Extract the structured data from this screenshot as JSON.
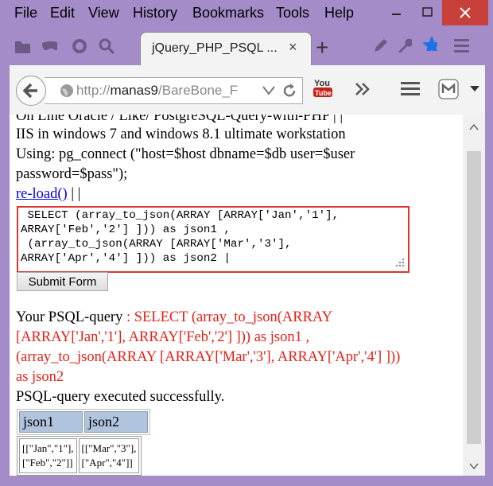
{
  "menu": [
    "File",
    "Edit",
    "View",
    "History",
    "Bookmarks",
    "Tools",
    "Help"
  ],
  "tab": {
    "title": "jQuery_PHP_PSQL ...",
    "close": "×",
    "new": "+"
  },
  "url": {
    "host": "manas9",
    "prefix": "http://",
    "path": "/BareBone_F"
  },
  "page": {
    "line0": "On Line Oracle / Like/ PostgreSQL-Query-with-PHP  | |",
    "line1": "IIS in windows 7 and windows 8.1 ultimate workstation",
    "line2": "Using: pg_connect (\"host=$host dbname=$db user=$user",
    "line3": "password=$pass\");",
    "reload": "re-load()",
    "reload_sep": " | |",
    "editor_lines": [
      " SELECT (array_to_json(ARRAY [ARRAY['Jan','1'],",
      "ARRAY['Feb','2'] ])) as json1 ,",
      " (array_to_json(ARRAY [ARRAY['Mar','3'],",
      "ARRAY['Apr','4'] ])) as json2 |"
    ],
    "submit": "Submit Form",
    "query_label": "Your PSQL-query",
    "query_lines": [
      " : SELECT (array_to_json(ARRAY",
      "[ARRAY['Jan','1'], ARRAY['Feb','2'] ])) as json1 ,",
      "(array_to_json(ARRAY [ARRAY['Mar','3'], ARRAY['Apr','4'] ]))",
      "as json2"
    ],
    "status": "PSQL-query executed successfully.",
    "table": {
      "headers": [
        "json1",
        "json2"
      ],
      "cells": [
        [
          "[[\"Jan\",\"1\"],",
          "[\"Feb\",\"2\"]]"
        ],
        [
          "[[\"Mar\",\"3\"],",
          "[\"Apr\",\"4\"]]"
        ]
      ]
    }
  }
}
